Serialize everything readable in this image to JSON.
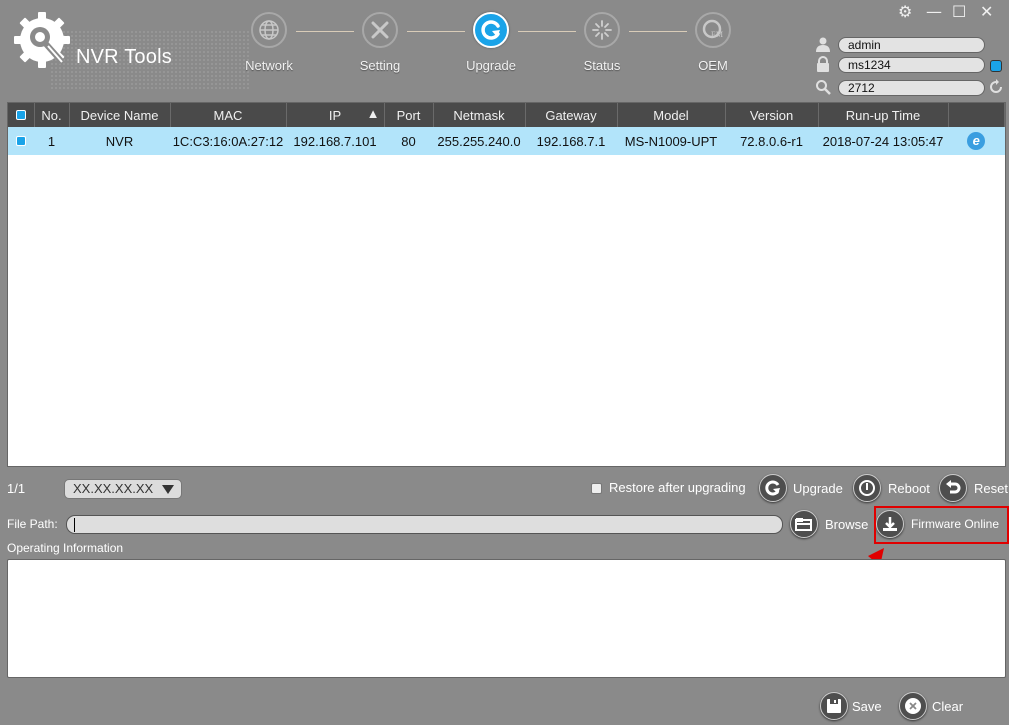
{
  "app": {
    "title": "NVR Tools"
  },
  "steps": [
    {
      "label": "Network",
      "icon": "globe-icon",
      "active": false
    },
    {
      "label": "Setting",
      "icon": "tools-icon",
      "active": false
    },
    {
      "label": "Upgrade",
      "icon": "upgrade-icon",
      "active": true
    },
    {
      "label": "Status",
      "icon": "status-icon",
      "active": false
    },
    {
      "label": "OEM",
      "icon": "oem-icon",
      "active": false
    }
  ],
  "window_controls": {
    "settings": "⚙",
    "minimize": "—",
    "maximize": "☐",
    "close": "✕"
  },
  "login": {
    "username": "admin",
    "password": "ms1234",
    "search": "2712",
    "remember_checked": true
  },
  "table": {
    "columns": [
      "",
      "No.",
      "Device Name",
      "MAC",
      "IP",
      "Port",
      "Netmask",
      "Gateway",
      "Model",
      "Version",
      "Run-up Time",
      ""
    ],
    "sort": {
      "column": "IP",
      "direction": "ascending",
      "glyph": "▲"
    },
    "rows": [
      {
        "checked": true,
        "no": "1",
        "device_name": "NVR",
        "mac": "1C:C3:16:0A:27:12",
        "ip": "192.168.7.101",
        "port": "80",
        "netmask": "255.255.240.0",
        "gateway": "192.168.7.1",
        "model": "MS-N1009-UPT",
        "version": "72.8.0.6-r1",
        "runup_time": "2018-07-24 13:05:47",
        "action_icon": "e"
      }
    ]
  },
  "pagination": {
    "page": "1/1"
  },
  "version_select": {
    "value": "XX.XX.XX.XX"
  },
  "actions": {
    "restore_label": "Restore after upgrading",
    "restore_checked": false,
    "upgrade": "Upgrade",
    "reboot": "Reboot",
    "reset": "Reset",
    "browse": "Browse",
    "firmware_online": "Firmware Online",
    "save": "Save",
    "clear": "Clear"
  },
  "file_path": {
    "label": "File Path:",
    "value": ""
  },
  "operating_info": {
    "label": "Operating Information",
    "value": ""
  },
  "annotation": {
    "highlight_color": "#e00000"
  }
}
